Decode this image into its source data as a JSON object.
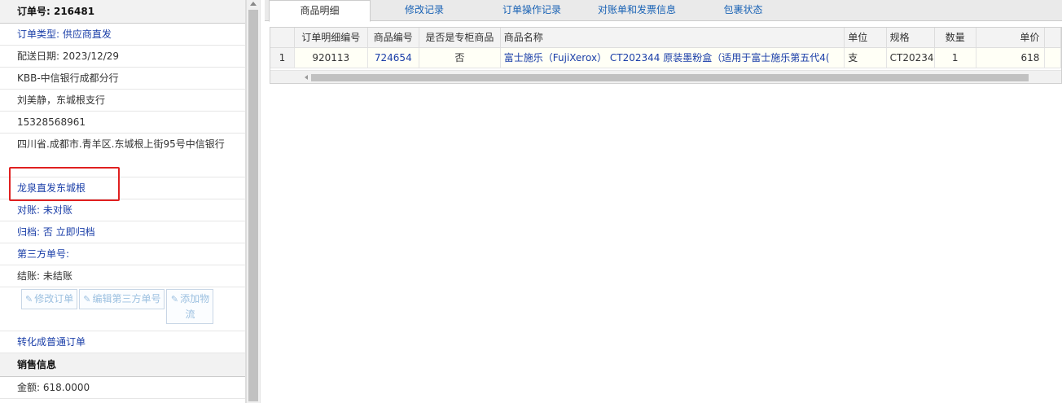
{
  "order": {
    "number_label": "订单号: 216481",
    "type": "订单类型: 供应商直发",
    "delivery_date": "配送日期: 2023/12/29",
    "customer": "KBB-中信银行成都分行",
    "contact": "刘美静，东城根支行",
    "phone": "15328568961",
    "address": "四川省.成都市.青羊区.东城根上街95号中信银行",
    "supplier": "龙泉直发东城根",
    "reconcile": "对账: 未对账",
    "archive": "归档: 否 立即归档",
    "third_party": "第三方单号:",
    "settlement": "结账: 未结账",
    "convert_link": "转化成普通订单"
  },
  "actions": {
    "edit_order": "修改订单",
    "edit_third": "编辑第三方单号",
    "add_logistics": "添加物流"
  },
  "sales": {
    "header": "销售信息",
    "amount": "金额: 618.0000"
  },
  "tabs": [
    {
      "label": "商品明细",
      "active": true
    },
    {
      "label": "修改记录",
      "active": false
    },
    {
      "label": "订单操作记录",
      "active": false
    },
    {
      "label": "对账单和发票信息",
      "active": false
    },
    {
      "label": "包裹状态",
      "active": false
    }
  ],
  "table": {
    "columns": [
      "",
      "订单明细编号",
      "商品编号",
      "是否是专柜商品",
      "商品名称",
      "单位",
      "规格",
      "数量",
      "单价"
    ],
    "rows": [
      [
        "1",
        "920113",
        "724654",
        "否",
        "富士施乐（FujiXerox） CT202344 原装墨粉盒（适用于富士施乐第五代4(",
        "支",
        "CT20234",
        "1",
        "618"
      ]
    ]
  },
  "colors": {
    "link": "#1a3ea8",
    "tab_link": "#1a63b5",
    "highlight_box": "#e02020"
  }
}
